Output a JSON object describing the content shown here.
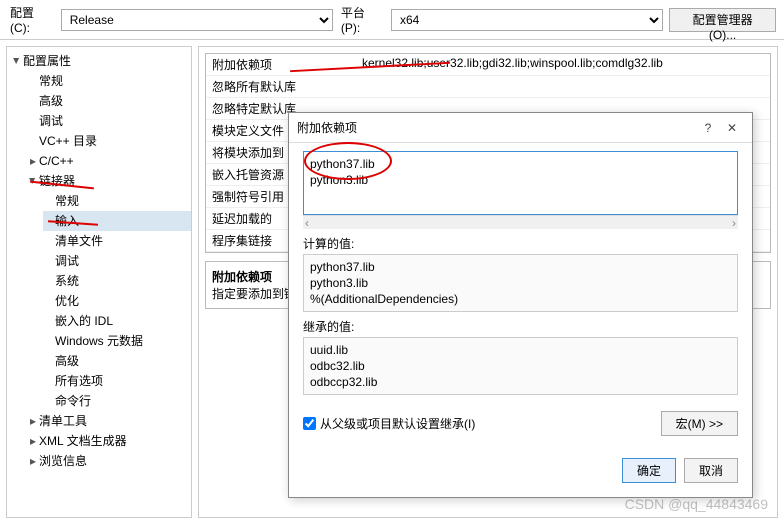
{
  "toolbar": {
    "config_label": "配置(C):",
    "config_value": "Release",
    "platform_label": "平台(P):",
    "platform_value": "x64",
    "manager_button": "配置管理器(O)..."
  },
  "tree": {
    "root": "配置属性",
    "items": [
      {
        "label": "常规",
        "leaf": true
      },
      {
        "label": "高级",
        "leaf": true
      },
      {
        "label": "调试",
        "leaf": true
      },
      {
        "label": "VC++ 目录",
        "leaf": true
      },
      {
        "label": "C/C++",
        "leaf": false,
        "expanded": false
      },
      {
        "label": "链接器",
        "leaf": false,
        "expanded": true,
        "children": [
          {
            "label": "常规"
          },
          {
            "label": "输入",
            "selected": true
          },
          {
            "label": "清单文件"
          },
          {
            "label": "调试"
          },
          {
            "label": "系统"
          },
          {
            "label": "优化"
          },
          {
            "label": "嵌入的 IDL"
          },
          {
            "label": "Windows 元数据"
          },
          {
            "label": "高级"
          },
          {
            "label": "所有选项"
          },
          {
            "label": "命令行"
          }
        ]
      },
      {
        "label": "清单工具",
        "leaf": false,
        "expanded": false
      },
      {
        "label": "XML 文档生成器",
        "leaf": false,
        "expanded": false
      },
      {
        "label": "浏览信息",
        "leaf": false,
        "expanded": false
      }
    ]
  },
  "properties": {
    "rows": [
      {
        "name": "附加依赖项",
        "value": "kernel32.lib;user32.lib;gdi32.lib;winspool.lib;comdlg32.lib"
      },
      {
        "name": "忽略所有默认库",
        "value": ""
      },
      {
        "name": "忽略特定默认库",
        "value": ""
      },
      {
        "name": "模块定义文件",
        "value": ""
      },
      {
        "name": "将模块添加到",
        "value": ""
      },
      {
        "name": "嵌入托管资源",
        "value": ""
      },
      {
        "name": "强制符号引用",
        "value": ""
      },
      {
        "name": "延迟加载的",
        "value": ""
      },
      {
        "name": "程序集链接",
        "value": ""
      }
    ],
    "desc_title": "附加依赖项",
    "desc_text": "指定要添加到链"
  },
  "dialog": {
    "title": "附加依赖项",
    "input_lines": [
      "python37.lib",
      "python3.lib"
    ],
    "computed_label": "计算的值:",
    "computed_lines": [
      "python37.lib",
      "python3.lib",
      "%(AdditionalDependencies)"
    ],
    "inherited_label": "继承的值:",
    "inherited_lines": [
      "uuid.lib",
      "odbc32.lib",
      "odbccp32.lib"
    ],
    "inherit_checkbox": "从父级或项目默认设置继承(I)",
    "inherit_checked": true,
    "macro_button": "宏(M) >>",
    "ok_button": "确定",
    "cancel_button": "取消"
  },
  "watermark": "CSDN @qq_44843469"
}
